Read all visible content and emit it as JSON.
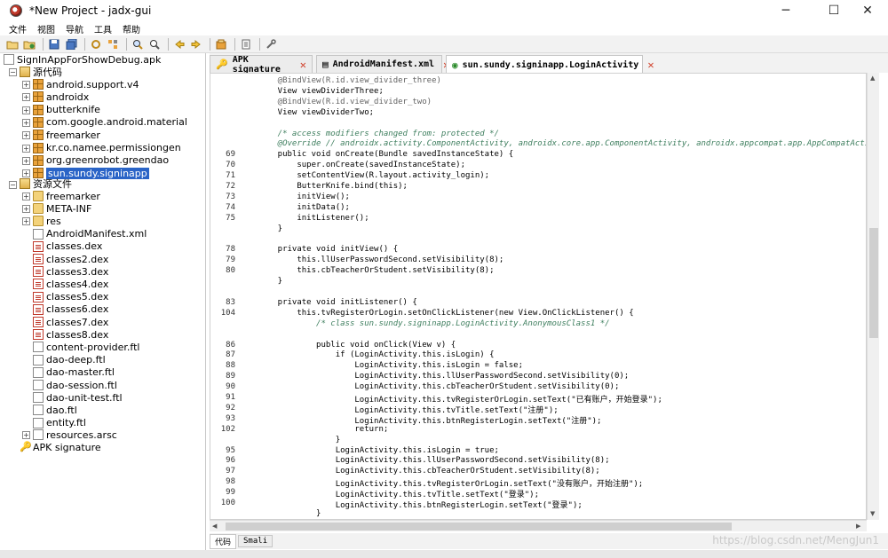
{
  "window": {
    "title": "*New Project - jadx-gui",
    "minimize": "─",
    "maximize": "☐",
    "close": "✕"
  },
  "menu": [
    "文件",
    "视图",
    "导航",
    "工具",
    "帮助"
  ],
  "toolbar_icons": [
    "open-icon",
    "add-file-icon",
    "save-icon",
    "save-all-icon",
    "sync-icon",
    "flatten-icon",
    "search-icon",
    "find-class-icon",
    "back-icon",
    "forward-icon",
    "deobfuscation-icon",
    "log-icon",
    "settings-icon"
  ],
  "tree": {
    "root": "SignInAppForShowDebug.apk",
    "source_folder": "源代码",
    "packages": [
      "android.support.v4",
      "androidx",
      "butterknife",
      "com.google.android.material",
      "freemarker",
      "kr.co.namee.permissiongen",
      "org.greenrobot.greendao",
      "sun.sundy.signinapp"
    ],
    "resource_folder": "资源文件",
    "resource_folders": [
      "freemarker",
      "META-INF",
      "res"
    ],
    "resource_files": [
      "AndroidManifest.xml",
      "classes.dex",
      "classes2.dex",
      "classes3.dex",
      "classes4.dex",
      "classes5.dex",
      "classes6.dex",
      "classes7.dex",
      "classes8.dex",
      "content-provider.ftl",
      "dao-deep.ftl",
      "dao-master.ftl",
      "dao-session.ftl",
      "dao-unit-test.ftl",
      "dao.ftl",
      "entity.ftl"
    ],
    "resources_arsc": "resources.arsc",
    "apk_signature": "APK signature"
  },
  "tabs": [
    {
      "label": "APK signature",
      "icon": "key-icon"
    },
    {
      "label": "AndroidManifest.xml",
      "icon": "xml-icon"
    },
    {
      "label": "sun.sundy.signinapp.LoginActivity",
      "icon": "class-icon"
    }
  ],
  "code": [
    {
      "n": "",
      "t": "    @BindView(R.id.view_divider_three)",
      "k": "ann"
    },
    {
      "n": "",
      "t": "    View viewDividerThree;",
      "k": ""
    },
    {
      "n": "",
      "t": "    @BindView(R.id.view_divider_two)",
      "k": "ann"
    },
    {
      "n": "",
      "t": "    View viewDividerTwo;",
      "k": ""
    },
    {
      "n": "",
      "t": "",
      "k": ""
    },
    {
      "n": "",
      "t": "    /* access modifiers changed from: protected */",
      "k": "cmt"
    },
    {
      "n": "",
      "t": "    @Override // androidx.activity.ComponentActivity, androidx.core.app.ComponentActivity, androidx.appcompat.app.AppCompatActivity, andr",
      "k": "cmt"
    },
    {
      "n": "69",
      "t": "    public void onCreate(Bundle savedInstanceState) {",
      "k": ""
    },
    {
      "n": "70",
      "t": "        super.onCreate(savedInstanceState);",
      "k": ""
    },
    {
      "n": "71",
      "t": "        setContentView(R.layout.activity_login);",
      "k": ""
    },
    {
      "n": "72",
      "t": "        ButterKnife.bind(this);",
      "k": ""
    },
    {
      "n": "73",
      "t": "        initView();",
      "k": ""
    },
    {
      "n": "74",
      "t": "        initData();",
      "k": ""
    },
    {
      "n": "75",
      "t": "        initListener();",
      "k": ""
    },
    {
      "n": "",
      "t": "    }",
      "k": ""
    },
    {
      "n": "",
      "t": "",
      "k": ""
    },
    {
      "n": "78",
      "t": "    private void initView() {",
      "k": ""
    },
    {
      "n": "79",
      "t": "        this.llUserPasswordSecond.setVisibility(8);",
      "k": ""
    },
    {
      "n": "80",
      "t": "        this.cbTeacherOrStudent.setVisibility(8);",
      "k": ""
    },
    {
      "n": "",
      "t": "    }",
      "k": ""
    },
    {
      "n": "",
      "t": "",
      "k": ""
    },
    {
      "n": "83",
      "t": "    private void initListener() {",
      "k": ""
    },
    {
      "n": "104",
      "t": "        this.tvRegisterOrLogin.setOnClickListener(new View.OnClickListener() {",
      "k": ""
    },
    {
      "n": "",
      "t": "            /* class sun.sundy.signinapp.LoginActivity.AnonymousClass1 */",
      "k": "cmt"
    },
    {
      "n": "",
      "t": "",
      "k": ""
    },
    {
      "n": "86",
      "t": "            public void onClick(View v) {",
      "k": ""
    },
    {
      "n": "87",
      "t": "                if (LoginActivity.this.isLogin) {",
      "k": ""
    },
    {
      "n": "88",
      "t": "                    LoginActivity.this.isLogin = false;",
      "k": ""
    },
    {
      "n": "89",
      "t": "                    LoginActivity.this.llUserPasswordSecond.setVisibility(0);",
      "k": ""
    },
    {
      "n": "90",
      "t": "                    LoginActivity.this.cbTeacherOrStudent.setVisibility(0);",
      "k": ""
    },
    {
      "n": "91",
      "t": "                    LoginActivity.this.tvRegisterOrLogin.setText(\"已有账户，开始登录\");",
      "k": ""
    },
    {
      "n": "92",
      "t": "                    LoginActivity.this.tvTitle.setText(\"注册\");",
      "k": ""
    },
    {
      "n": "93",
      "t": "                    LoginActivity.this.btnRegisterLogin.setText(\"注册\");",
      "k": ""
    },
    {
      "n": "102",
      "t": "                    return;",
      "k": ""
    },
    {
      "n": "",
      "t": "                }",
      "k": ""
    },
    {
      "n": "95",
      "t": "                LoginActivity.this.isLogin = true;",
      "k": ""
    },
    {
      "n": "96",
      "t": "                LoginActivity.this.llUserPasswordSecond.setVisibility(8);",
      "k": ""
    },
    {
      "n": "97",
      "t": "                LoginActivity.this.cbTeacherOrStudent.setVisibility(8);",
      "k": ""
    },
    {
      "n": "98",
      "t": "                LoginActivity.this.tvRegisterOrLogin.setText(\"没有账户，开始注册\");",
      "k": ""
    },
    {
      "n": "99",
      "t": "                LoginActivity.this.tvTitle.setText(\"登录\");",
      "k": ""
    },
    {
      "n": "100",
      "t": "                LoginActivity.this.btnRegisterLogin.setText(\"登录\");",
      "k": ""
    },
    {
      "n": "",
      "t": "            }",
      "k": ""
    }
  ],
  "bottom_tabs": [
    "代码",
    "Smali"
  ],
  "watermark": "https://blog.csdn.net/MengJun1"
}
